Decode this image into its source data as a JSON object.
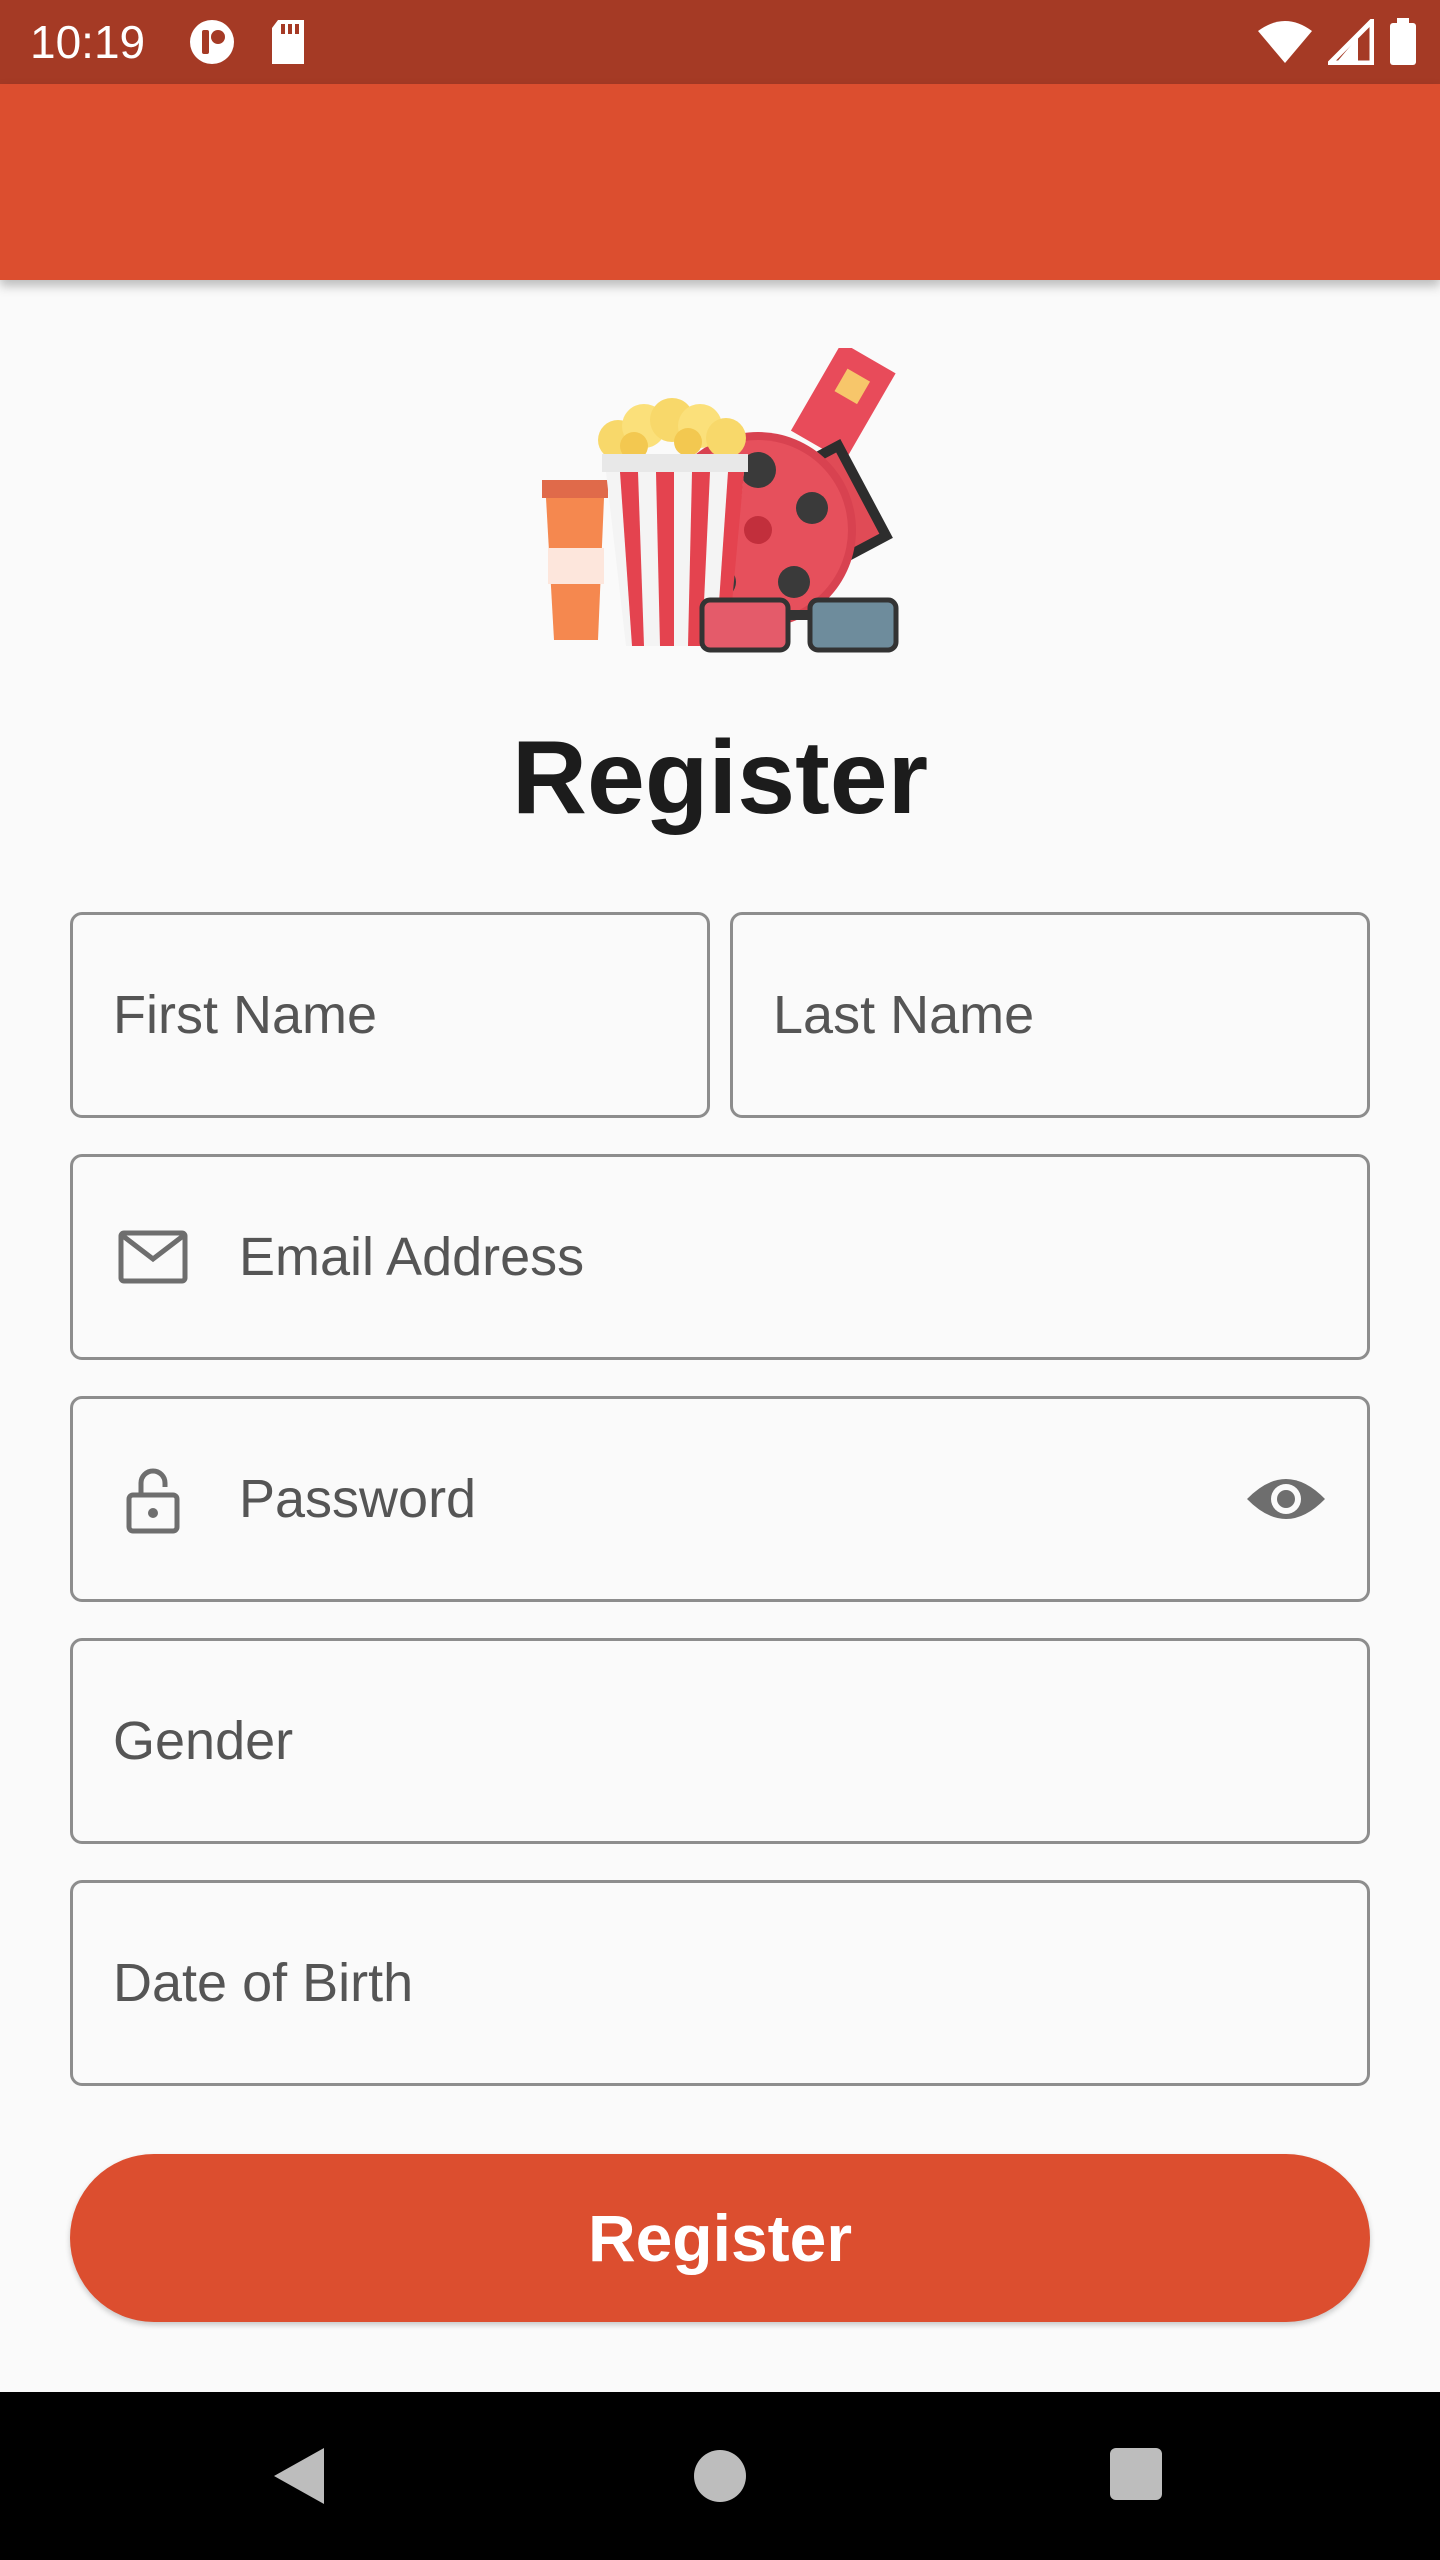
{
  "status_bar": {
    "time": "10:19",
    "left_icons": [
      "app-notification-icon",
      "sd-card-icon"
    ],
    "right_icons": [
      "wifi-icon",
      "cellular-signal-icon",
      "battery-icon"
    ]
  },
  "colors": {
    "primary": "#dc4e2f",
    "status_bar": "#a53a25",
    "border": "#8d8d8d"
  },
  "header": {
    "logo": "cinema-popcorn-logo"
  },
  "form": {
    "title": "Register",
    "first_name_placeholder": "First Name",
    "last_name_placeholder": "Last Name",
    "email_placeholder": "Email Address",
    "password_placeholder": "Password",
    "gender_placeholder": "Gender",
    "dob_placeholder": "Date of Birth",
    "submit_label": "Register"
  },
  "nav": {
    "buttons": [
      "back",
      "home",
      "recents"
    ]
  }
}
